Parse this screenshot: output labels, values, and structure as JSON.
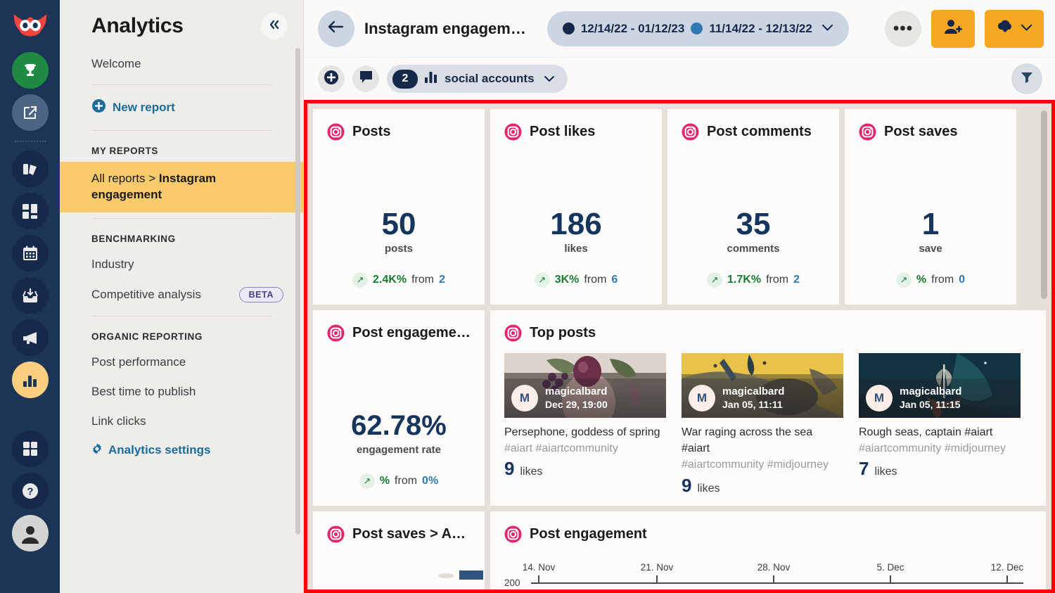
{
  "brand": {
    "accent_amber": "#f8a723",
    "navy": "#1c3557",
    "instagram_pink": "#e0266f",
    "highlight_red": "#ff0000",
    "positive_green": "#1a7a33"
  },
  "rail": {
    "items": [
      {
        "name": "hootsuite-owl-logo",
        "icon": "owl-logo-icon"
      },
      {
        "name": "rewards-trophy",
        "icon": "trophy-icon"
      },
      {
        "name": "compose",
        "icon": "compose-pencil-icon"
      },
      {
        "name": "streams",
        "icon": "streams-icon"
      },
      {
        "name": "planner-grid",
        "icon": "grid-panels-icon"
      },
      {
        "name": "calendar",
        "icon": "calendar-icon"
      },
      {
        "name": "inbox",
        "icon": "inbox-download-icon"
      },
      {
        "name": "advertise",
        "icon": "megaphone-icon"
      },
      {
        "name": "analytics",
        "icon": "bar-chart-icon"
      },
      {
        "name": "apps",
        "icon": "four-squares-icon"
      },
      {
        "name": "help",
        "icon": "question-mark-icon"
      },
      {
        "name": "profile",
        "icon": "user-avatar-icon"
      }
    ]
  },
  "sidebar": {
    "title": "Analytics",
    "collapse_icon": "chevron-double-left-icon",
    "welcome_label": "Welcome",
    "new_report_label": "New report",
    "my_reports_heading": "MY REPORTS",
    "active_report_prefix": "All reports > ",
    "active_report_name": "Instagram engagement",
    "benchmarking_heading": "BENCHMARKING",
    "industry_label": "Industry",
    "competitive_label": "Competitive analysis",
    "beta_badge": "BETA",
    "organic_heading": "ORGANIC REPORTING",
    "post_performance_label": "Post performance",
    "best_time_label": "Best time to publish",
    "link_clicks_label": "Link clicks",
    "settings_label": "Analytics settings"
  },
  "topbar": {
    "back_icon": "arrow-left-icon",
    "report_title": "Instagram engagem…",
    "date_current": "12/14/22 - 01/12/23",
    "date_previous": "11/14/22 - 12/13/22",
    "date_chevron": "chevron-down-icon",
    "more_label": "•••",
    "invite_icon": "add-user-icon",
    "export_icon": "cloud-download-icon",
    "export_chevron": "chevron-down-icon"
  },
  "toolbar": {
    "add_icon": "plus-circle-icon",
    "comment_icon": "comment-icon",
    "accounts_count": "2",
    "accounts_chart_icon": "bar-chart-small-icon",
    "accounts_label": "social accounts",
    "accounts_chevron": "chevron-down-icon",
    "filter_icon": "filter-funnel-icon"
  },
  "metrics": [
    {
      "network_icon": "instagram-icon",
      "title": "Posts",
      "value": "50",
      "unit": "posts",
      "delta_arrow": "arrow-up-right-icon",
      "delta_pct": "2.4K%",
      "from_label": "from",
      "baseline": "2"
    },
    {
      "network_icon": "instagram-icon",
      "title": "Post likes",
      "value": "186",
      "unit": "likes",
      "delta_arrow": "arrow-up-right-icon",
      "delta_pct": "3K%",
      "from_label": "from",
      "baseline": "6"
    },
    {
      "network_icon": "instagram-icon",
      "title": "Post comments",
      "value": "35",
      "unit": "comments",
      "delta_arrow": "arrow-up-right-icon",
      "delta_pct": "1.7K%",
      "from_label": "from",
      "baseline": "2"
    },
    {
      "network_icon": "instagram-icon",
      "title": "Post saves",
      "value": "1",
      "unit": "save",
      "delta_arrow": "arrow-up-right-icon",
      "delta_pct": "%",
      "from_label": "from",
      "baseline": "0"
    }
  ],
  "engagement_rate": {
    "network_icon": "instagram-icon",
    "title": "Post engageme…",
    "value": "62.78%",
    "unit": "engagement rate",
    "delta_arrow": "arrow-up-right-icon",
    "delta_pct": "%",
    "from_label": "from",
    "baseline": "0%"
  },
  "top_posts": {
    "network_icon": "instagram-icon",
    "title": "Top posts",
    "likes_label": "likes",
    "posts": [
      {
        "avatar_initial": "M",
        "username": "magicalbard",
        "date": "Dec 29, 19:00",
        "caption": "Persephone, goddess of spring",
        "tags": "#aiart #aiartcommunity",
        "likes": "9"
      },
      {
        "avatar_initial": "M",
        "username": "magicalbard",
        "date": "Jan 05, 11:11",
        "caption": "War raging across the sea #aiart",
        "tags": "#aiartcommunity #midjourney",
        "likes": "9"
      },
      {
        "avatar_initial": "M",
        "username": "magicalbard",
        "date": "Jan 05, 11:15",
        "caption": "Rough seas, captain #aiart",
        "tags": "#aiartcommunity #midjourney",
        "likes": "7"
      }
    ]
  },
  "saves_card": {
    "network_icon": "instagram-icon",
    "title": "Post saves > Ac…"
  },
  "chart_data": {
    "type": "line",
    "network_icon": "instagram-icon",
    "title": "Post engagement",
    "xlabel": "",
    "ylabel": "",
    "grid": false,
    "legend": "none",
    "categories": [
      "14. Nov",
      "21. Nov",
      "28. Nov",
      "5. Dec",
      "12. Dec"
    ],
    "x_tick_labels": [
      "14. Nov",
      "21. Nov",
      "28. Nov",
      "5. Dec",
      "12. Dec"
    ],
    "y_tick_labels": [
      "200"
    ],
    "ylim": [
      0,
      200
    ],
    "series": [
      {
        "name": "Post engagement",
        "values": []
      }
    ],
    "note": "Chart is cut off at the bottom of the viewport; only the top axis label row is visible."
  }
}
